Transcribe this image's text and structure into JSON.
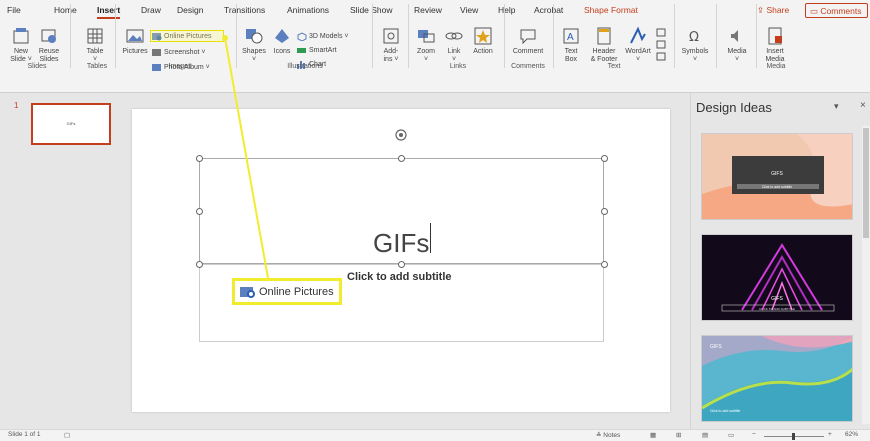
{
  "menu": {
    "tabs": [
      "File",
      "Home",
      "Insert",
      "Draw",
      "Design",
      "Transitions",
      "Animations",
      "Slide Show",
      "Review",
      "View",
      "Help",
      "Acrobat",
      "Shape Format"
    ],
    "share_label": "Share",
    "comments_label": "Comments"
  },
  "ribbon": {
    "new_slide": "New\nSlide ˅",
    "reuse_slides": "Reuse\nSlides",
    "table": "Table\n˅",
    "pictures": "Pictures",
    "online_pictures": "Online Pictures",
    "screenshot": "Screenshot ˅",
    "photo_album": "Photo Album ˅",
    "shapes": "Shapes\n˅",
    "icons": "Icons",
    "models_3d": "3D Models ˅",
    "smartart": "SmartArt",
    "chart": "Chart",
    "addins": "Add-\nins ˅",
    "zoom": "Zoom\n˅",
    "link": "Link\n˅",
    "action": "Action",
    "comment": "Comment",
    "text_box": "Text\nBox",
    "header_footer": "Header\n& Footer",
    "wordart": "WordArt\n˅",
    "symbols": "Symbols\n˅",
    "media": "Media\n˅",
    "insert_media": "Insert\nMedia",
    "groups": {
      "slides": "Slides",
      "tables": "Tables",
      "images": "Images",
      "illustrations": "Illustrations",
      "links": "Links",
      "comments": "Comments",
      "text": "Text",
      "media": "Media"
    }
  },
  "thumbs": {
    "slide_number": "1",
    "thumb_text": "GIFs"
  },
  "slide": {
    "title": "GIFs",
    "subtitle": "Click to add subtitle",
    "callout": "Online Pictures"
  },
  "design": {
    "title": "Design Ideas",
    "card1_text": "GIFS",
    "card1_sub": "Click to add subtitle",
    "card2_text": "GIFS",
    "card2_sub": "CLICK TO ADD SUBTITLE",
    "card3_text": "GIFS",
    "card3_sub": "Click to add subtitle"
  },
  "status": {
    "slide_of": "Slide 1 of 1",
    "notes": "Notes",
    "zoom": "62%"
  },
  "colors": {
    "accent": "#c43e1c",
    "highlight": "#f2ec2e"
  }
}
